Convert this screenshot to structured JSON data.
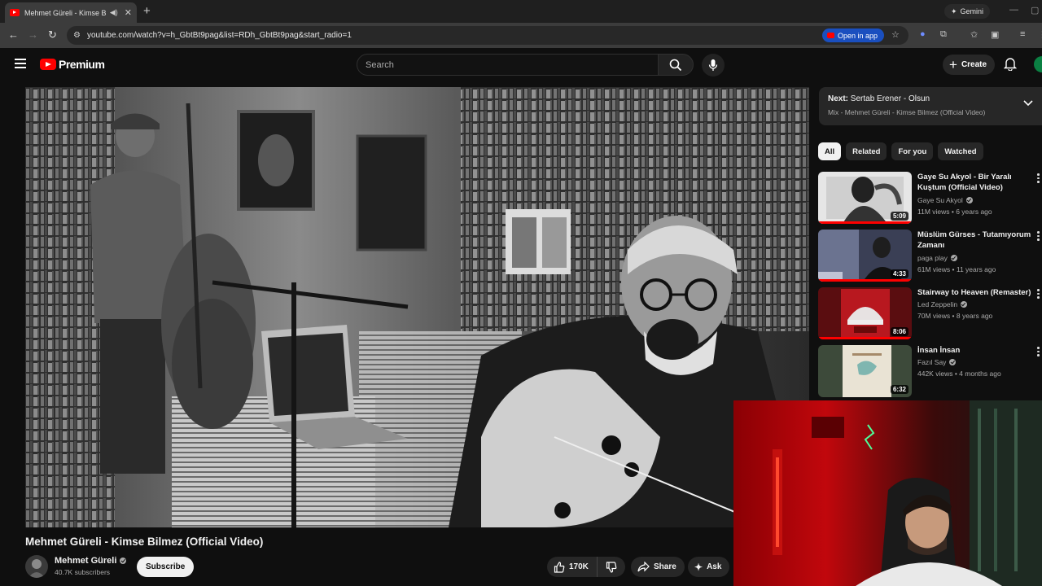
{
  "browser": {
    "tab_title": "Mehmet Güreli - Kimse Bilm",
    "new_tab_label": "+",
    "gemini_label": "Gemini",
    "url": "youtube.com/watch?v=h_GbtBt9pag&list=RDh_GbtBt9pag&start_radio=1",
    "open_in_app_label": "Open in app"
  },
  "header": {
    "brand": "Premium",
    "search_placeholder": "Search",
    "create_label": "Create"
  },
  "video": {
    "title": "Mehmet Güreli - Kimse Bilmez (Official Video)",
    "channel": "Mehmet Güreli",
    "subscribers": "40.7K subscribers",
    "subscribe_label": "Subscribe",
    "likes": "170K",
    "share_label": "Share",
    "ask_label": "Ask"
  },
  "next": {
    "prefix": "Next:",
    "title": "Sertab Erener - Olsun",
    "mix": "Mix - Mehmet Güreli - Kimse Bilmez (Official Video)"
  },
  "chips": [
    "All",
    "Related",
    "For you",
    "Watched"
  ],
  "recommendations": [
    {
      "title": "Gaye Su Akyol - Bir Yaralı Kuştum (Official Video)",
      "channel": "Gaye Su Akyol",
      "meta": "11M views • 6 years ago",
      "duration": "5:09",
      "watched": 1.0
    },
    {
      "title": "Müslüm Gürses - Tutamıyorum Zamanı",
      "channel": "paga play",
      "meta": "61M views • 11 years ago",
      "duration": "4:33",
      "watched": 1.0
    },
    {
      "title": "Stairway to Heaven (Remaster)",
      "channel": "Led Zeppelin",
      "meta": "70M views • 8 years ago",
      "duration": "8:06",
      "watched": 1.0
    },
    {
      "title": "İnsan İnsan",
      "channel": "Fazıl Say",
      "meta": "442K views • 4 months ago",
      "duration": "6:32",
      "watched": 0.0
    }
  ],
  "colors": {
    "background": "#0f0f0f",
    "accent_red": "#ff0000",
    "chip_bg": "#272727",
    "open_app_blue": "#1a4fbf"
  }
}
